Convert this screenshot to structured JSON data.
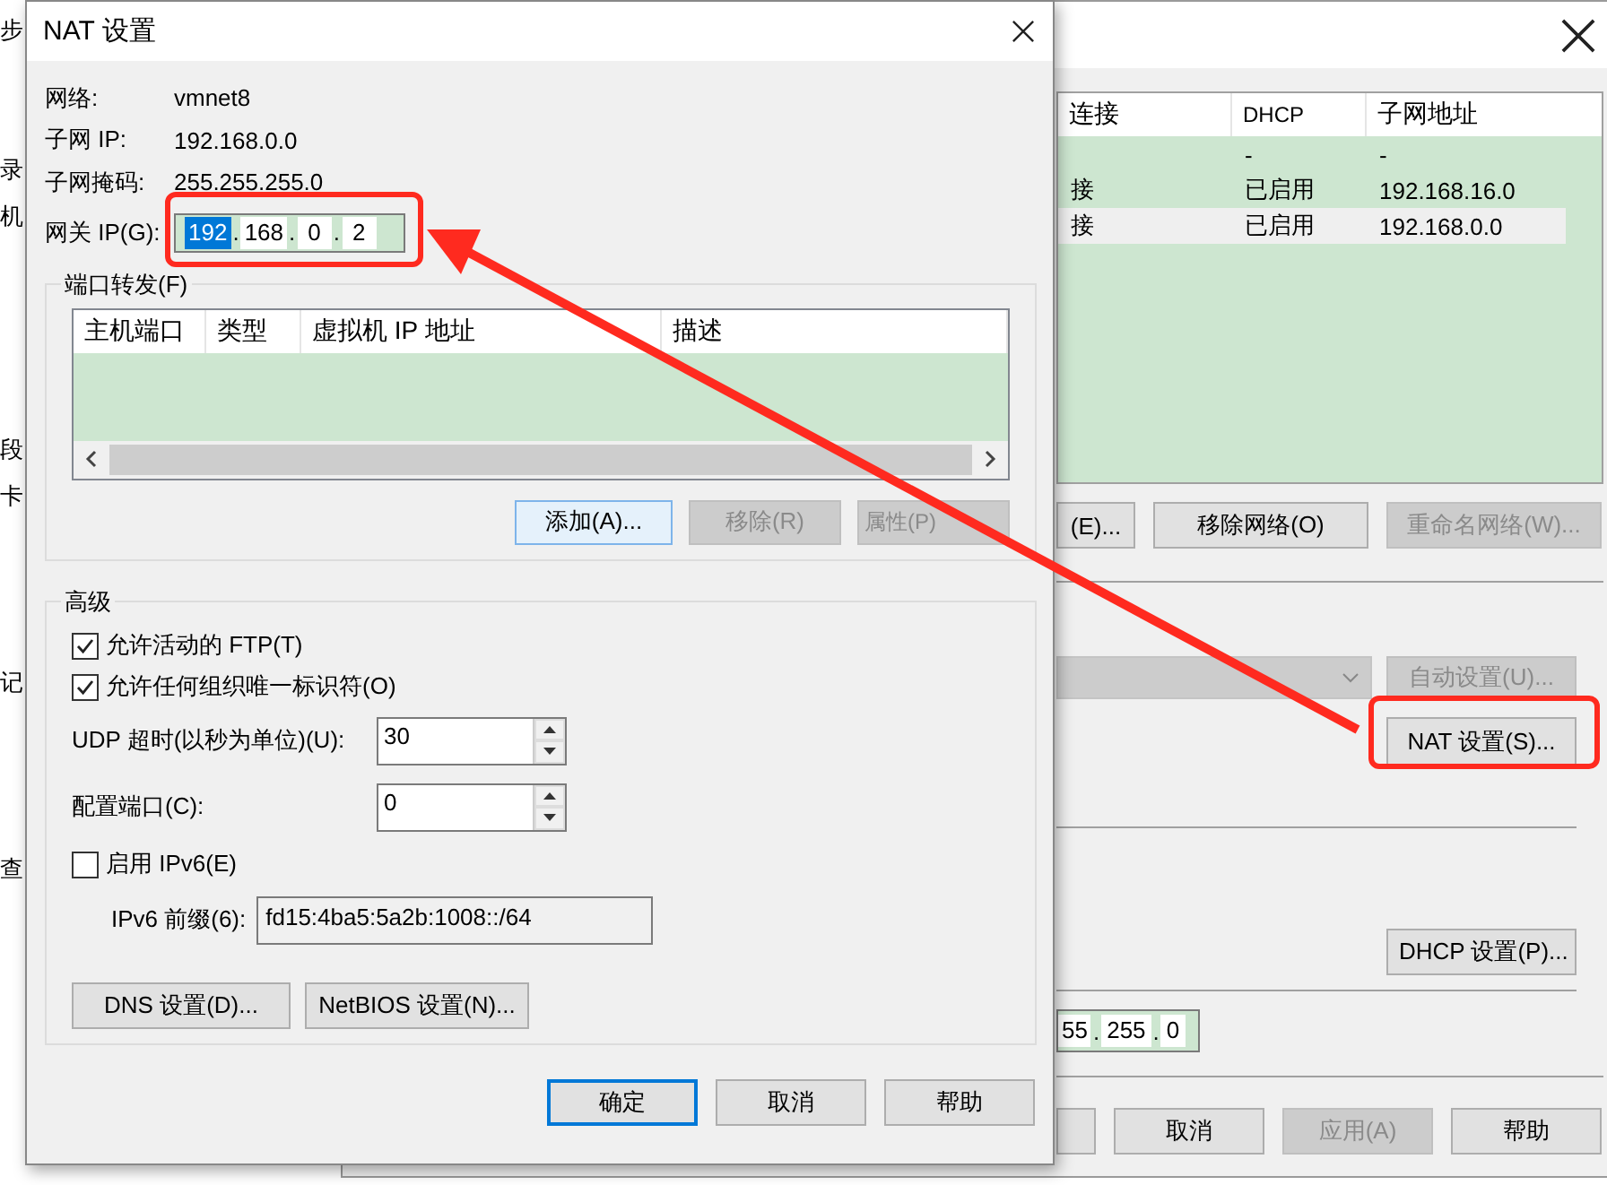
{
  "document_fragments": [
    {
      "kind": "text",
      "text": "步"
    },
    {
      "kind": "blank"
    },
    {
      "kind": "blank"
    },
    {
      "kind": "text",
      "text": "录"
    },
    {
      "kind": "text",
      "text": "机"
    },
    {
      "kind": "blank"
    },
    {
      "kind": "blank"
    },
    {
      "kind": "blank"
    },
    {
      "kind": "blank"
    },
    {
      "kind": "text",
      "text": "段"
    },
    {
      "kind": "text",
      "text": "卡"
    },
    {
      "kind": "blank"
    },
    {
      "kind": "blank"
    },
    {
      "kind": "blank"
    },
    {
      "kind": "text",
      "text": "记"
    },
    {
      "kind": "blank"
    },
    {
      "kind": "blank"
    },
    {
      "kind": "blank"
    },
    {
      "kind": "text",
      "text": "查"
    }
  ],
  "background_window": {
    "table": {
      "columns": [
        "连接",
        "DHCP",
        "子网地址"
      ],
      "rows": [
        {
          "dhcp": "-",
          "subnet": "-",
          "selected": false
        },
        {
          "connection": "接",
          "dhcp": "已启用",
          "subnet": "192.168.16.0",
          "selected": false
        },
        {
          "connection": "接",
          "dhcp": "已启用",
          "subnet": "192.168.0.0",
          "selected": true
        }
      ]
    },
    "network_buttons": [
      {
        "label": "(E)...",
        "disabled": false
      },
      {
        "label": "移除网络(O)",
        "disabled": false
      },
      {
        "label": "重命名网络(W)...",
        "disabled": true
      }
    ],
    "bridge_dropdown": {
      "disabled": true
    },
    "auto_settings_button": {
      "label": "自动设置(U)...",
      "disabled": true
    },
    "nat_settings_button": {
      "label": "NAT 设置(S)...",
      "disabled": false
    },
    "dhcp_settings_button": {
      "label": "DHCP 设置(P)...",
      "disabled": false
    },
    "subnet_mask": {
      "separator": ".",
      "octets": [
        "55",
        "255",
        "0"
      ]
    },
    "footer_buttons": [
      {
        "label": "取消",
        "disabled": false
      },
      {
        "label": "应用(A)",
        "disabled": true
      },
      {
        "label": "帮助",
        "disabled": false
      }
    ]
  },
  "nat_dialog": {
    "title": "NAT 设置",
    "info": [
      {
        "label": "网络:",
        "value": "vmnet8"
      },
      {
        "label": "子网 IP:",
        "value": "192.168.0.0"
      },
      {
        "label": "子网掩码:",
        "value": "255.255.255.0"
      }
    ],
    "gateway": {
      "label": "网关 IP(G):",
      "separator": ".",
      "octets": [
        {
          "text": "192",
          "selected": true
        },
        {
          "text": "168",
          "selected": false
        },
        {
          "text": "0",
          "selected": false
        },
        {
          "text": "2",
          "selected": false
        }
      ]
    },
    "port_forwarding": {
      "title": "端口转发(F)",
      "columns": [
        "主机端口",
        "类型",
        "虚拟机 IP 地址",
        "描述"
      ],
      "buttons": [
        {
          "label": "添加(A)...",
          "disabled": false
        },
        {
          "label": "移除(R)",
          "disabled": true
        },
        {
          "label": "属性(P)",
          "disabled": true
        }
      ]
    },
    "advanced": {
      "title": "高级",
      "checkboxes": [
        {
          "label": "允许活动的 FTP(T)",
          "checked": true
        },
        {
          "label": "允许任何组织唯一标识符(O)",
          "checked": true
        }
      ],
      "spinners": [
        {
          "label": "UDP 超时(以秒为单位)(U):",
          "value": "30"
        },
        {
          "label": "配置端口(C):",
          "value": "0"
        }
      ],
      "ipv6": {
        "label": "启用 IPv6(E)",
        "checked": false
      },
      "ipv6_prefix": {
        "label": "IPv6 前缀(6):",
        "value": "fd15:4ba5:5a2b:1008::/64"
      },
      "buttons": [
        "DNS 设置(D)...",
        "NetBIOS 设置(N)..."
      ]
    },
    "footer_buttons": [
      {
        "label": "确定",
        "default": true
      },
      {
        "label": "取消",
        "default": false
      },
      {
        "label": "帮助",
        "default": false
      }
    ]
  }
}
